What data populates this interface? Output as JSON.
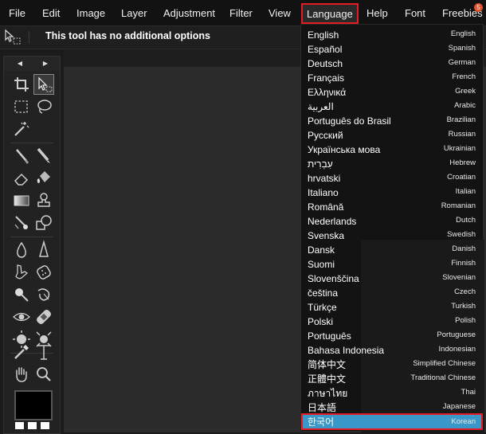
{
  "menubar": {
    "items": [
      {
        "label": "File"
      },
      {
        "label": "Edit"
      },
      {
        "label": "Image"
      },
      {
        "label": "Layer"
      },
      {
        "label": "Adjustment"
      },
      {
        "label": "Filter"
      },
      {
        "label": "View"
      },
      {
        "label": "Language"
      },
      {
        "label": "Help"
      },
      {
        "label": "Font"
      },
      {
        "label": "Freebies"
      }
    ],
    "freebies_badge": "5",
    "selected_item": "Language"
  },
  "options_bar": {
    "tool_icon": "transform-selection-icon",
    "message": "This tool has no additional options"
  },
  "tool_panel": {
    "nav_prev": "◀",
    "nav_next": "▶",
    "tools": [
      "crop-icon",
      "select-arrow-icon",
      "rect-marquee-icon",
      "lasso-icon",
      "magic-wand-icon",
      "brush-icon",
      "pencil-icon",
      "eraser-icon",
      "paint-bucket-icon",
      "gradient-icon",
      "stamp-icon",
      "color-replace-icon",
      "shape-icon",
      "blur-icon",
      "sharpen-icon",
      "smudge-icon",
      "sponge-icon",
      "dodge-icon",
      "burn-icon",
      "red-eye-icon",
      "spot-heal-icon",
      "bloat-icon",
      "pinch-icon",
      "color-picker-icon",
      "type-icon",
      "hand-icon",
      "zoom-icon"
    ],
    "primary_color": "#000000",
    "secondary_color": "#ffffff"
  },
  "language_menu": {
    "items": [
      {
        "native": "English",
        "english": "English"
      },
      {
        "native": "Español",
        "english": "Spanish"
      },
      {
        "native": "Deutsch",
        "english": "German"
      },
      {
        "native": "Français",
        "english": "French"
      },
      {
        "native": "Ελληνικά",
        "english": "Greek"
      },
      {
        "native": "العربية",
        "english": "Arabic"
      },
      {
        "native": "Português do Brasil",
        "english": "Brazilian"
      },
      {
        "native": "Русский",
        "english": "Russian"
      },
      {
        "native": "Українська мова",
        "english": "Ukrainian"
      },
      {
        "native": "עִבְרִית",
        "english": "Hebrew"
      },
      {
        "native": "hrvatski",
        "english": "Croatian"
      },
      {
        "native": "Italiano",
        "english": "Italian"
      },
      {
        "native": "Română",
        "english": "Romanian"
      },
      {
        "native": "Nederlands",
        "english": "Dutch"
      },
      {
        "native": "Svenska",
        "english": "Swedish"
      },
      {
        "native": "Dansk",
        "english": "Danish"
      },
      {
        "native": "Suomi",
        "english": "Finnish"
      },
      {
        "native": "Slovenščina",
        "english": "Slovenian"
      },
      {
        "native": "čeština",
        "english": "Czech"
      },
      {
        "native": "Türkçe",
        "english": "Turkish"
      },
      {
        "native": "Polski",
        "english": "Polish"
      },
      {
        "native": "Português",
        "english": "Portuguese"
      },
      {
        "native": "Bahasa Indonesia",
        "english": "Indonesian"
      },
      {
        "native": "简体中文",
        "english": "Simplified Chinese"
      },
      {
        "native": "正體中文",
        "english": "Traditional Chinese"
      },
      {
        "native": "ภาษาไทย",
        "english": "Thai"
      },
      {
        "native": "日本語",
        "english": "Japanese"
      },
      {
        "native": "한국어",
        "english": "Korean"
      }
    ],
    "highlighted": "Korean"
  },
  "colors": {
    "highlight_bg": "#3a98c8",
    "annotation_border": "#e51c23",
    "badge": "#e0512c"
  }
}
